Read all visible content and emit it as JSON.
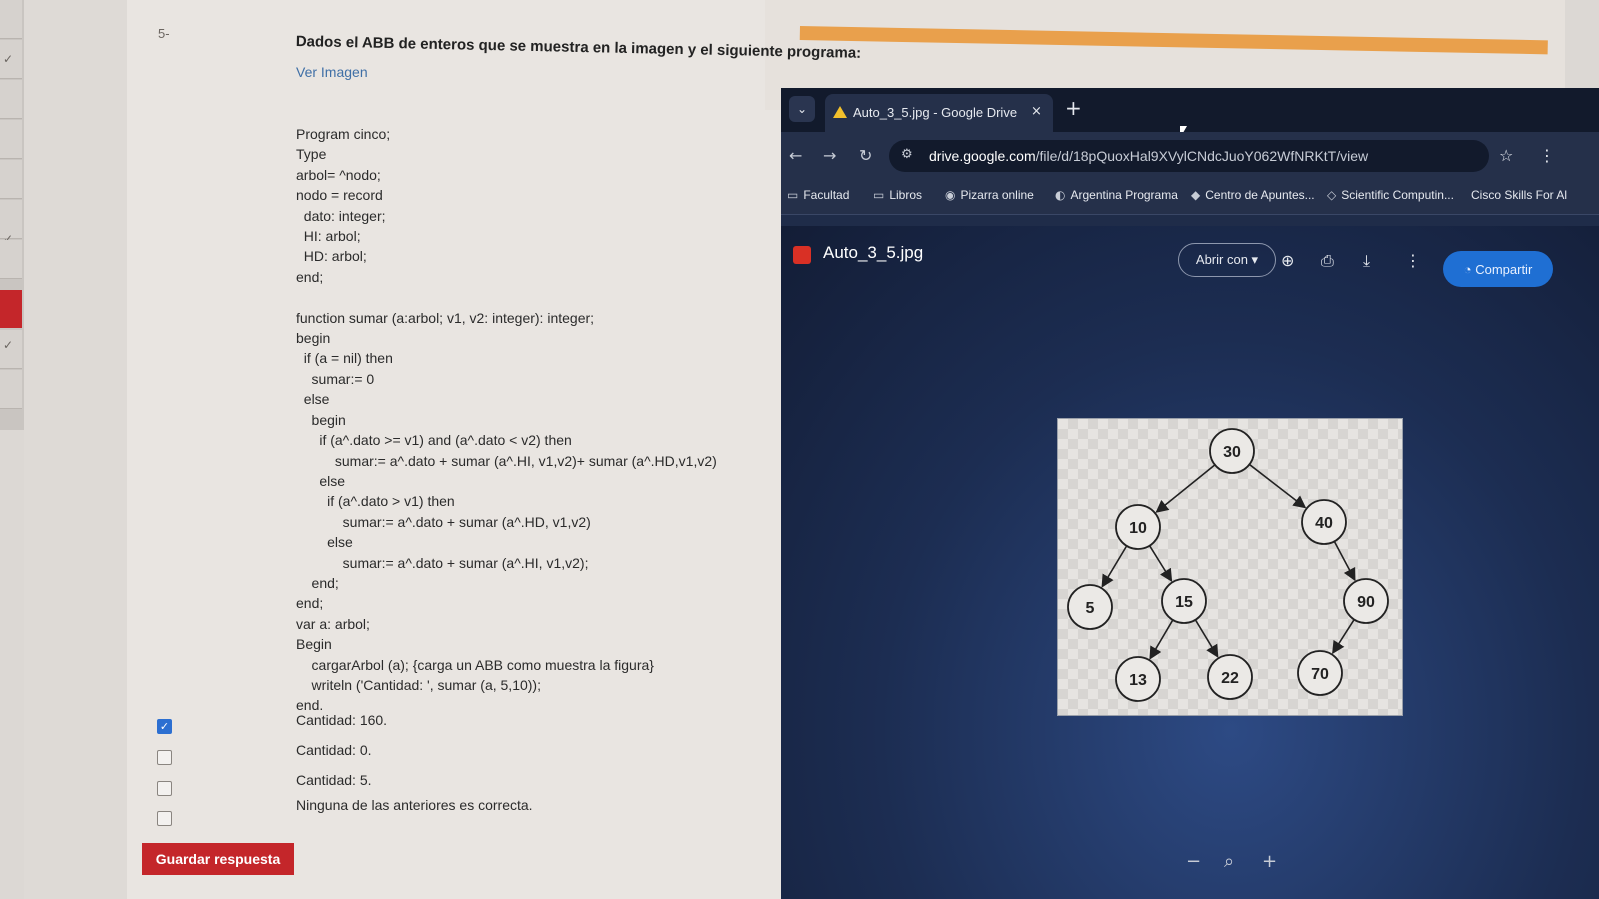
{
  "question": {
    "number": "5-",
    "prompt": "Dados el ABB de enteros que se muestra en la imagen y el siguiente programa:",
    "link": "Ver Imagen",
    "code": "Program cinco;\nType\narbol= ^nodo;\nnodo = record\n  dato: integer;\n  HI: arbol;\n  HD: arbol;\nend;\n\nfunction sumar (a:arbol; v1, v2: integer): integer;\nbegin\n  if (a = nil) then\n    sumar:= 0\n  else\n    begin\n      if (a^.dato >= v1) and (a^.dato < v2) then\n          sumar:= a^.dato + sumar (a^.HI, v1,v2)+ sumar (a^.HD,v1,v2)\n      else\n        if (a^.dato > v1) then\n            sumar:= a^.dato + sumar (a^.HD, v1,v2)\n        else\n            sumar:= a^.dato + sumar (a^.HI, v1,v2);\n    end;\nend;\nvar a: arbol;\nBegin\n    cargarArbol (a); {carga un ABB como muestra la figura}\n    writeln ('Cantidad: ', sumar (a, 5,10));\nend.",
    "options": [
      {
        "label": "Cantidad: 160.",
        "checked": true
      },
      {
        "label": "Cantidad: 0.",
        "checked": false
      },
      {
        "label": "Cantidad: 5.",
        "checked": false
      },
      {
        "label": "Ninguna de las anteriores es correcta.",
        "checked": false
      }
    ],
    "save_label": "Guardar respuesta"
  },
  "browser": {
    "tab_title": "Auto_3_5.jpg - Google Drive",
    "tab_close": "×",
    "new_tab": "+",
    "url_host": "drive.google.com",
    "url_path": "/file/d/18pQuoxHal9XVylCNdcJuoY062WfNRKtT/view",
    "bookmarks": [
      {
        "label": "Facultad",
        "icon": "folder-icon"
      },
      {
        "label": "Libros",
        "icon": "folder-icon"
      },
      {
        "label": "Pizarra online",
        "icon": "pizarra-icon"
      },
      {
        "label": "Argentina Programa",
        "icon": "argentina-icon"
      },
      {
        "label": "Centro de Apuntes...",
        "icon": "apuntes-icon"
      },
      {
        "label": "Scientific Computin...",
        "icon": "scientific-icon"
      },
      {
        "label": "Cisco Skills For Al",
        "icon": "cisco-icon"
      }
    ],
    "file_title": "Auto_3_5.jpg",
    "open_with": "Abrir con",
    "share": "Compartir"
  },
  "tree": {
    "nodes": [
      "30",
      "10",
      "40",
      "5",
      "15",
      "90",
      "13",
      "22",
      "70"
    ],
    "edges": [
      [
        "30",
        "10"
      ],
      [
        "30",
        "40"
      ],
      [
        "10",
        "5"
      ],
      [
        "10",
        "15"
      ],
      [
        "40",
        "90"
      ],
      [
        "15",
        "13"
      ],
      [
        "15",
        "22"
      ],
      [
        "90",
        "70"
      ]
    ]
  },
  "colors": {
    "accent_red": "#c4262a",
    "share_blue": "#1f6fd3",
    "checkbox_blue": "#2c6fd1",
    "link_blue": "#3f6fa6"
  }
}
